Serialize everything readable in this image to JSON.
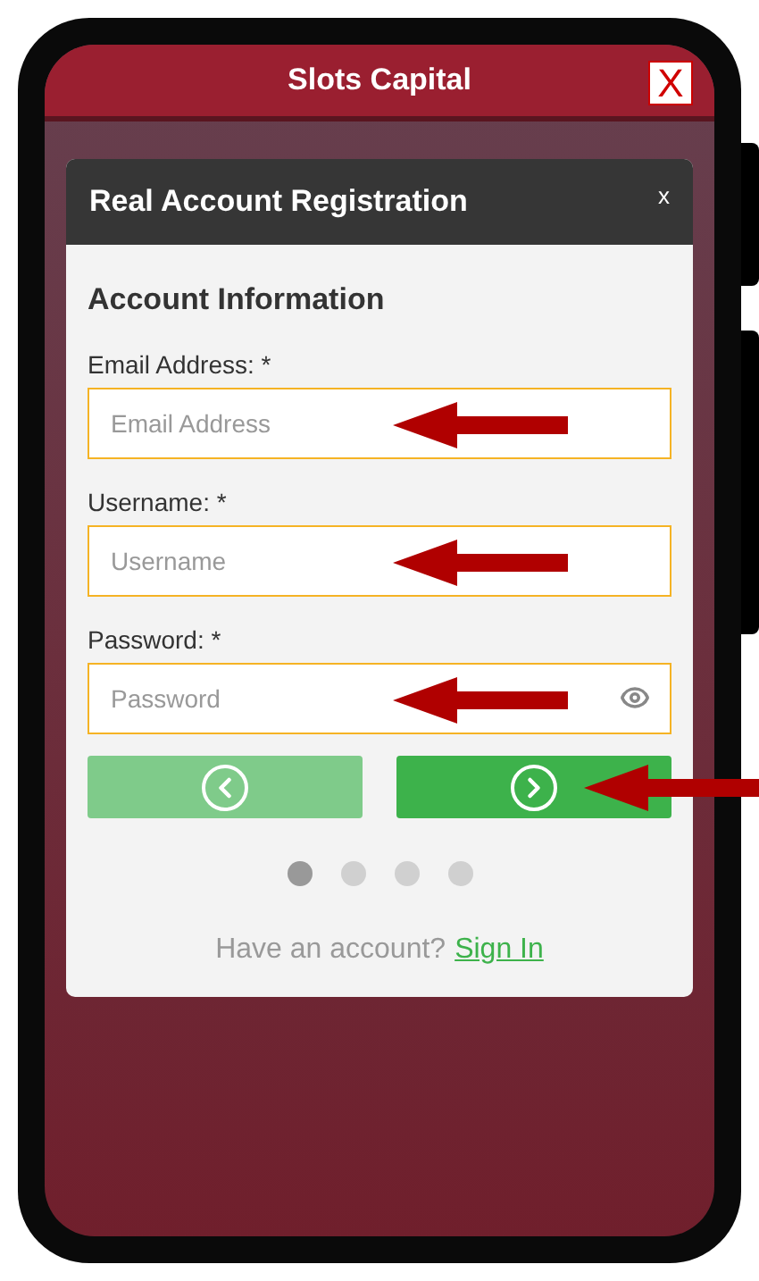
{
  "app_bar": {
    "title": "Slots Capital",
    "close_label": "X"
  },
  "modal": {
    "title": "Real Account Registration",
    "close_label": "x",
    "section_title": "Account Information",
    "fields": [
      {
        "kind": "text",
        "label": "Email Address: *",
        "placeholder": "Email Address"
      },
      {
        "kind": "text",
        "label": "Username: *",
        "placeholder": "Username"
      },
      {
        "kind": "password",
        "label": "Password: *",
        "placeholder": "Password"
      }
    ],
    "nav_buttons": [
      {
        "kind": "back",
        "disabled": true
      },
      {
        "kind": "next",
        "disabled": false
      }
    ],
    "steps": [
      {
        "selected": true
      },
      {
        "selected": false
      },
      {
        "selected": false
      },
      {
        "selected": false
      }
    ],
    "footer": {
      "text": "Have an account?",
      "link": "Sign In"
    }
  }
}
